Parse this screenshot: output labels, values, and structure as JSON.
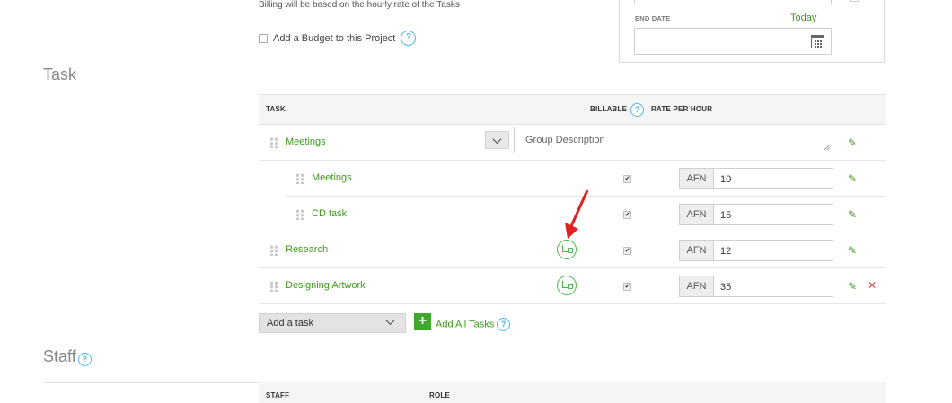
{
  "project": {
    "billing_note": "Billing will be based on the hourly rate of the Tasks",
    "budget_label": "Add a Budget to this Project",
    "help_glyph": "?"
  },
  "dates": {
    "end_label": "END DATE",
    "today_link": "Today",
    "end_value": ""
  },
  "task_section": {
    "title": "Task",
    "headers": {
      "task": "TASK",
      "billable": "BILLABLE",
      "rate": "RATE PER HOUR"
    },
    "group": {
      "name": "Meetings",
      "description_placeholder": "Group Description"
    },
    "rows": [
      {
        "name": "Meetings",
        "billable": true,
        "currency": "AFN",
        "rate": "10",
        "indent": true
      },
      {
        "name": "CD task",
        "billable": true,
        "currency": "AFN",
        "rate": "15",
        "indent": true
      },
      {
        "name": "Research",
        "billable": true,
        "currency": "AFN",
        "rate": "12",
        "indent": false
      },
      {
        "name": "Designing Artwork",
        "billable": true,
        "currency": "AFN",
        "rate": "35",
        "indent": false
      }
    ],
    "add_task_placeholder": "Add a task",
    "add_all_label": "Add All Tasks"
  },
  "staff_section": {
    "title": "Staff",
    "headers": {
      "staff": "STAFF",
      "role": "ROLE"
    }
  },
  "colors": {
    "accent_green": "#3f9a1e",
    "help_blue": "#4db8e6",
    "delete_red": "#d9534f",
    "annotation_red": "#e02020"
  },
  "icons": {
    "drag": "drag-handle-icon",
    "edit": "pencil-icon",
    "delete": "close-icon",
    "calendar": "calendar-icon",
    "subtask": "subtask-link-icon",
    "add": "plus-icon"
  }
}
